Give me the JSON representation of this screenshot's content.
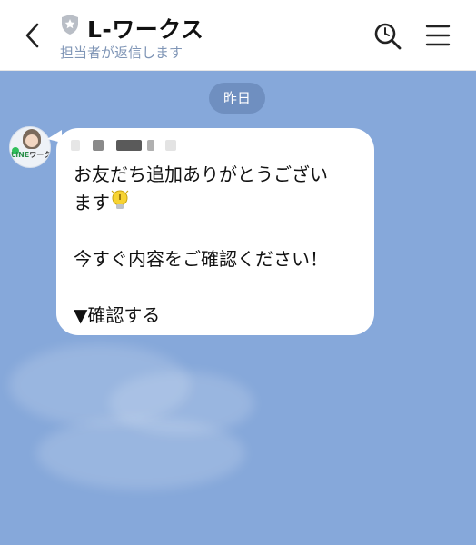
{
  "header": {
    "title": "L-ワークス",
    "subtitle": "担当者が返信します"
  },
  "chat": {
    "date_label": "昨日",
    "avatar": {
      "logo_text_green": "LINE",
      "logo_text_dark": "ワークス"
    },
    "message": {
      "line1": "お友だち追加ありがとうござい",
      "line2": "ます",
      "line3": "今すぐ内容をご確認ください！",
      "line4": "▼確認する",
      "emoji": "lightbulb-emoji"
    }
  },
  "colors": {
    "chat_background": "#86a8da",
    "date_pill": "#6f8fc0",
    "subtitle": "#7f95b6",
    "bubble": "#ffffff"
  }
}
